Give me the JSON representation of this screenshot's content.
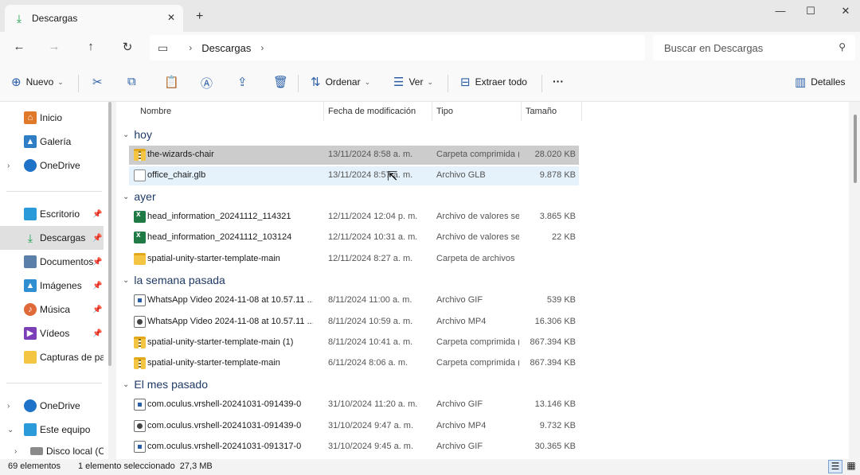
{
  "window": {
    "tab_title": "Descargas",
    "tab_icon": "download-icon",
    "new_tab": "+",
    "close_tab": "✕"
  },
  "address": {
    "crumb": "Descargas",
    "search_placeholder": "Buscar en Descargas"
  },
  "commands": {
    "nuevo": "Nuevo",
    "ordenar": "Ordenar",
    "ver": "Ver",
    "extraer": "Extraer todo",
    "mas": "···",
    "detalles": "Detalles"
  },
  "sidebar": {
    "items": [
      {
        "label": "Inicio",
        "icon": "home-icon"
      },
      {
        "label": "Galería",
        "icon": "gallery-icon"
      },
      {
        "label": "OneDrive",
        "icon": "cloud-icon"
      },
      {
        "label": "Escritorio",
        "icon": "desktop-icon"
      },
      {
        "label": "Descargas",
        "icon": "download-icon"
      },
      {
        "label": "Documentos",
        "icon": "documents-icon"
      },
      {
        "label": "Imágenes",
        "icon": "images-icon"
      },
      {
        "label": "Música",
        "icon": "music-icon"
      },
      {
        "label": "Vídeos",
        "icon": "videos-icon"
      },
      {
        "label": "Capturas de pantalla",
        "icon": "folder-icon"
      },
      {
        "label": "OneDrive",
        "icon": "cloud-icon"
      },
      {
        "label": "Este equipo",
        "icon": "pc-icon"
      },
      {
        "label": "Disco local (C:)",
        "icon": "drive-icon"
      }
    ]
  },
  "columns": {
    "name": "Nombre",
    "date": "Fecha de modificación",
    "type": "Tipo",
    "size": "Tamaño"
  },
  "groups": [
    {
      "label": "hoy",
      "rows": [
        {
          "name": "the-wizards-chair",
          "date": "13/11/2024 8:58 a. m.",
          "type": "Carpeta comprimida (en zip)",
          "size": "28.020 KB",
          "icon": "zip"
        },
        {
          "name": "office_chair.glb",
          "date": "13/11/2024 8:57 a. m.",
          "type": "Archivo GLB",
          "size": "9.878 KB",
          "icon": "file"
        }
      ]
    },
    {
      "label": "ayer",
      "rows": [
        {
          "name": "head_information_20241112_114321",
          "date": "12/11/2024 12:04 p. m.",
          "type": "Archivo de valores separados por comas",
          "size": "3.865 KB",
          "icon": "csv"
        },
        {
          "name": "head_information_20241112_103124",
          "date": "12/11/2024 10:31 a. m.",
          "type": "Archivo de valores separados por comas",
          "size": "22 KB",
          "icon": "csv"
        },
        {
          "name": "spatial-unity-starter-template-main",
          "date": "12/11/2024 8:27 a. m.",
          "type": "Carpeta de archivos",
          "size": "",
          "icon": "folder"
        }
      ]
    },
    {
      "label": "la semana pasada",
      "rows": [
        {
          "name": "WhatsApp Video 2024-11-08 at 10.57.11 ...",
          "date": "8/11/2024 11:00 a. m.",
          "type": "Archivo GIF",
          "size": "539 KB",
          "icon": "gif"
        },
        {
          "name": "WhatsApp Video 2024-11-08 at 10.57.11 ...",
          "date": "8/11/2024 10:59 a. m.",
          "type": "Archivo MP4",
          "size": "16.306 KB",
          "icon": "mp4"
        },
        {
          "name": "spatial-unity-starter-template-main (1)",
          "date": "8/11/2024 10:41 a. m.",
          "type": "Carpeta comprimida (en zip)",
          "size": "867.394 KB",
          "icon": "zip"
        },
        {
          "name": "spatial-unity-starter-template-main",
          "date": "6/11/2024 8:06 a. m.",
          "type": "Carpeta comprimida (en zip)",
          "size": "867.394 KB",
          "icon": "zip"
        }
      ]
    },
    {
      "label": "El mes pasado",
      "rows": [
        {
          "name": "com.oculus.vrshell-20241031-091439-0",
          "date": "31/10/2024 11:20 a. m.",
          "type": "Archivo GIF",
          "size": "13.146 KB",
          "icon": "gif"
        },
        {
          "name": "com.oculus.vrshell-20241031-091439-0",
          "date": "31/10/2024 9:47 a. m.",
          "type": "Archivo MP4",
          "size": "9.732 KB",
          "icon": "mp4"
        },
        {
          "name": "com.oculus.vrshell-20241031-091317-0",
          "date": "31/10/2024 9:45 a. m.",
          "type": "Archivo GIF",
          "size": "30.365 KB",
          "icon": "gif"
        }
      ]
    }
  ],
  "status": {
    "count": "69 elementos",
    "selection": "1 elemento seleccionado  27,3 MB"
  }
}
